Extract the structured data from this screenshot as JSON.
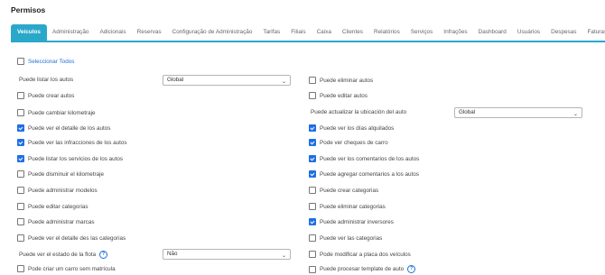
{
  "page": {
    "title": "Permisos"
  },
  "tabs": [
    "Veículos",
    "Administração",
    "Adicionais",
    "Reservas",
    "Configuração de Administração",
    "Tarifas",
    "Filiais",
    "Caixa",
    "Clientes",
    "Relatórios",
    "Serviços",
    "Infrações",
    "Dashboard",
    "Usuários",
    "Despesas",
    "Faturas"
  ],
  "active_tab": "Veículos",
  "select_all": "Seleccionar Todos",
  "left": [
    {
      "label": "Puede listar los autos",
      "type": "select",
      "value": "Global"
    },
    {
      "label": "Puede crear autos",
      "type": "checkbox",
      "checked": false
    },
    {
      "label": "Puede cambiar kilometraje",
      "type": "checkbox",
      "checked": false
    },
    {
      "label": "Puede ver el detalle de los autos",
      "type": "checkbox",
      "checked": true
    },
    {
      "label": "Puede ver las infracciones de los autos",
      "type": "checkbox",
      "checked": true
    },
    {
      "label": "Puede listar los servicios de los autos",
      "type": "checkbox",
      "checked": true
    },
    {
      "label": "Puede disminuir el kilometraje",
      "type": "checkbox",
      "checked": false
    },
    {
      "label": "Puede administrar modelos",
      "type": "checkbox",
      "checked": false
    },
    {
      "label": "Puede editar categorias",
      "type": "checkbox",
      "checked": false
    },
    {
      "label": "Puede administrar marcas",
      "type": "checkbox",
      "checked": false
    },
    {
      "label": "Puede ver el detalle des las categorias",
      "type": "checkbox",
      "checked": false
    },
    {
      "label": "Puede ver el estado de la flota",
      "type": "select",
      "value": "Não",
      "help": true
    },
    {
      "label": "Pode criar um carro sem matrícula",
      "type": "checkbox",
      "checked": false
    }
  ],
  "right": [
    {
      "label": "Puede eliminar autos",
      "type": "checkbox",
      "checked": false
    },
    {
      "label": "Puede editar autos",
      "type": "checkbox",
      "checked": false
    },
    {
      "label": "Puede actualizar la ubicación del auto",
      "type": "select",
      "value": "Global"
    },
    {
      "label": "Puede ver los días alquilados",
      "type": "checkbox",
      "checked": true
    },
    {
      "label": "Pode ver cheques de carro",
      "type": "checkbox",
      "checked": true
    },
    {
      "label": "Puede ver los comentarios de los autos",
      "type": "checkbox",
      "checked": true
    },
    {
      "label": "Puede agregar comentarios a los autos",
      "type": "checkbox",
      "checked": true
    },
    {
      "label": "Puede crear categorias",
      "type": "checkbox",
      "checked": false
    },
    {
      "label": "Puede eliminar categorias",
      "type": "checkbox",
      "checked": false
    },
    {
      "label": "Puede administrar inversores",
      "type": "checkbox",
      "checked": true
    },
    {
      "label": "Puede ver las categorias",
      "type": "checkbox",
      "checked": false
    },
    {
      "label": "Pode modificar a placa dos veículos",
      "type": "checkbox",
      "checked": false
    },
    {
      "label": "Puede procesar template de auto",
      "type": "checkbox",
      "checked": false,
      "help": true
    }
  ],
  "colors": {
    "accent": "#2aa8c9",
    "checkbox": "#1f6fe5",
    "link": "#1e6fd9"
  }
}
